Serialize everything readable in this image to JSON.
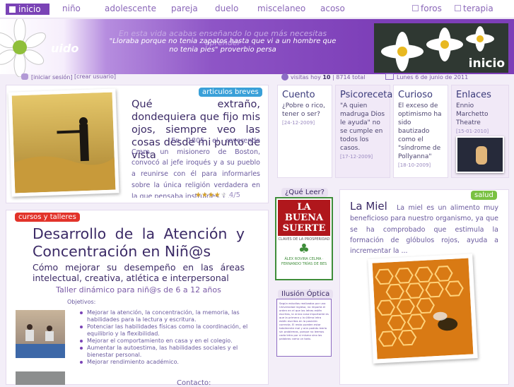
{
  "nav": {
    "home": "inicio",
    "links": [
      "niño",
      "adolescente",
      "pareja",
      "duelo",
      "miscelaneo",
      "acoso"
    ],
    "foros": "foros",
    "terapia": "terapia"
  },
  "banner": {
    "logo_text": "uido",
    "title": "En esta vida acabas enseñando lo que más necesitas aprender",
    "quote": "\"Lloraba porque no tenia zapatos hasta que vi a un hombre que no tenia pies\" proverbio persa",
    "image_label": "inicio"
  },
  "subbar": {
    "login": "[iniciar sesión]",
    "create": "[crear usuario]",
    "visits_label": "visitas hoy",
    "visits_today": "10",
    "visits_total": "8714 total",
    "date": "Lunes 6 de junio de 2011"
  },
  "article": {
    "tag": "articulos breves",
    "title": "Qué extraño, dondequiera que fijo mis ojos, siempre veo las cosas desde mi punto de vista",
    "body": "En 1805 el reverendo Cram, un misionero de Boston, convocó al jefe iroqués y a su pueblo a reunirse con él para informarles sobre la única religión verdadera en la que pensaba instruirles. ( ...",
    "rating": "4/5",
    "stars_filled": 4,
    "stars_total": 5
  },
  "minis": [
    {
      "title": "Cuento",
      "text": "¿Pobre o rico, tener o ser?",
      "date": "[24-12-2009]"
    },
    {
      "title": "Psicoreceta",
      "text": "\"A quien madruga Dios le ayuda\" no se cumple en todos los casos.",
      "date": "[17-12-2009]"
    },
    {
      "title": "Curioso",
      "text": "El exceso de optimismo ha sido bautizado como el \"síndrome de Pollyanna\"",
      "date": "[18-10-2009]"
    },
    {
      "title": "Enlaces",
      "text": "Ennio Marchetto Theatre",
      "date": "[15-01-2010]"
    }
  ],
  "courses": {
    "tag": "cursos y talleres",
    "title": "Desarrollo de la Atención y Concentración en Niñ@s",
    "subtitle": "Cómo mejorar su desempeño en las áreas intelectual, creativa, atlética e interpersonal",
    "workshop": "Taller dinámico para niñ@s de 6 a 12 años",
    "objectives_label": "Objetivos:",
    "objectives": [
      "Mejorar la atención, la concentración, la memoria, las habilidades para la lectura y escritura.",
      "Potenciar las habilidades físicas como la coordinación, el equilibrio y la flexibilidad.",
      "Mejorar el comportamiento en casa y en el colegio.",
      "Aumentar la autoestima, las habilidades sociales y el bienestar personal.",
      "Mejorar rendimiento académico."
    ],
    "contact": "Contacto:"
  },
  "reading": {
    "tag": "¿Qué Leer?",
    "book_title": "LA BUENA SUERTE",
    "book_sub": "CLAVES DE LA PROSPERIDAD",
    "book_authors": "ÁLEX ROVIRA CELMA · FERNANDO TRÍAS DE BES"
  },
  "illusion": {
    "tag": "Ilusión Óptica",
    "text": "Según estudios realizados por una Universidad inglesa, no importa el orden en el que las letras estén escritas, la única cosa importante es que la primera y la última letra estén escritas en la posición correcta. El resto pueden estar totalmente mal y aún podrás leerlo sin problemas, porque no leemos cada letra por sí misma sino las palabras como un todo."
  },
  "health": {
    "tag": "salud",
    "title": "La Miel",
    "body": "La miel es un alimento muy beneficioso para nuestro organismo, ya que se ha comprobado que estimula la formación de glóbulos rojos, ayuda a incrementar la ..."
  },
  "colors": {
    "accent": "#7a43b6",
    "tag_blue": "#3aa0d8",
    "tag_red": "#e2332a",
    "tag_green": "#7ac142"
  }
}
